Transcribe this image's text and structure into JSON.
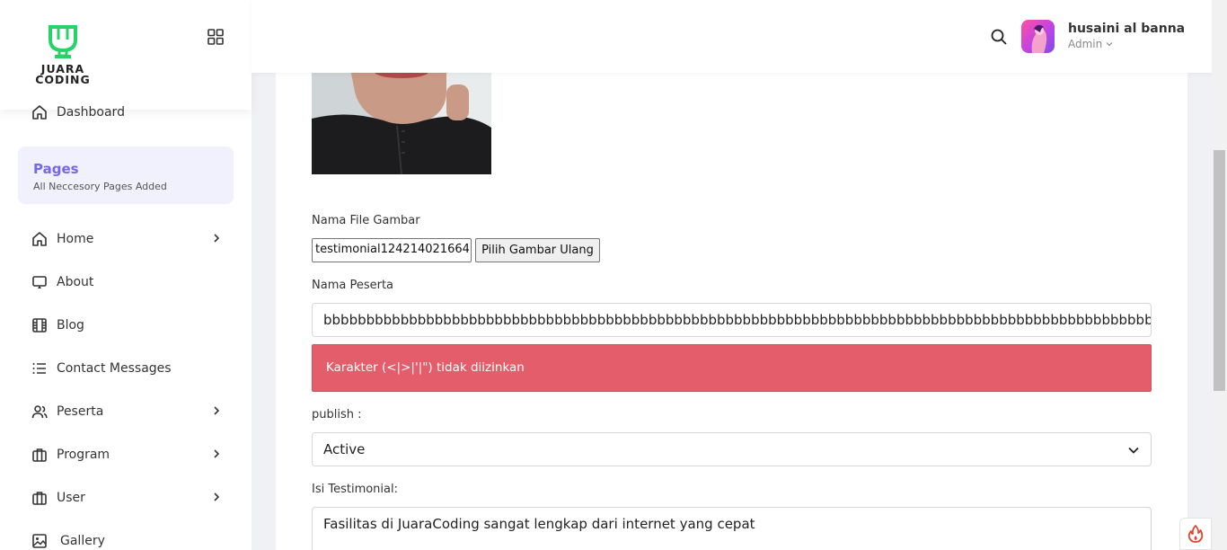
{
  "brand": {
    "logo_text_line1": "JUARA",
    "logo_text_line2": "CODING",
    "accent_color": "#25d366"
  },
  "sidebar": {
    "dashboard_label": "Dashboard",
    "pages_section": {
      "title": "Pages",
      "subtitle": "All Neccesory Pages Added"
    },
    "items": [
      {
        "label": "Home",
        "icon": "home-icon",
        "has_submenu": true
      },
      {
        "label": "About",
        "icon": "monitor-icon",
        "has_submenu": false
      },
      {
        "label": "Blog",
        "icon": "film-icon",
        "has_submenu": false
      },
      {
        "label": "Contact Messages",
        "icon": "list-icon",
        "has_submenu": false
      },
      {
        "label": "Peserta",
        "icon": "users-icon",
        "has_submenu": true
      },
      {
        "label": "Program",
        "icon": "briefcase-icon",
        "has_submenu": true
      },
      {
        "label": "User",
        "icon": "briefcase-icon",
        "has_submenu": true
      },
      {
        "label": "Gallery",
        "icon": "image-icon",
        "has_submenu": false
      }
    ]
  },
  "header": {
    "user_name": "husaini al banna",
    "user_role": "Admin"
  },
  "form": {
    "file_label": "Nama File Gambar",
    "file_value": "testimonial124214021664",
    "file_button": "Pilih Gambar Ulang",
    "name_label": "Nama Peserta",
    "name_value": "bbbbbbbbbbbbbbbbbbbbbbbbbbbbbbbbbbbbbbbbbbbbbbbbbbbbbbbbbbbbbbbbbbbbbbbbbbbbbbbbbbbbbbbbbbbbbbbbbbbbb",
    "error_message": "Karakter (<|>|'|\") tidak diizinkan",
    "publish_label": "publish :",
    "publish_value": "Active",
    "testimonial_label": "Isi Testimonial:",
    "testimonial_value": "Fasilitas di JuaraCoding sangat lengkap dari internet yang cepat"
  },
  "colors": {
    "alert_bg": "#e35d6a",
    "pages_accent": "#7367f0"
  }
}
